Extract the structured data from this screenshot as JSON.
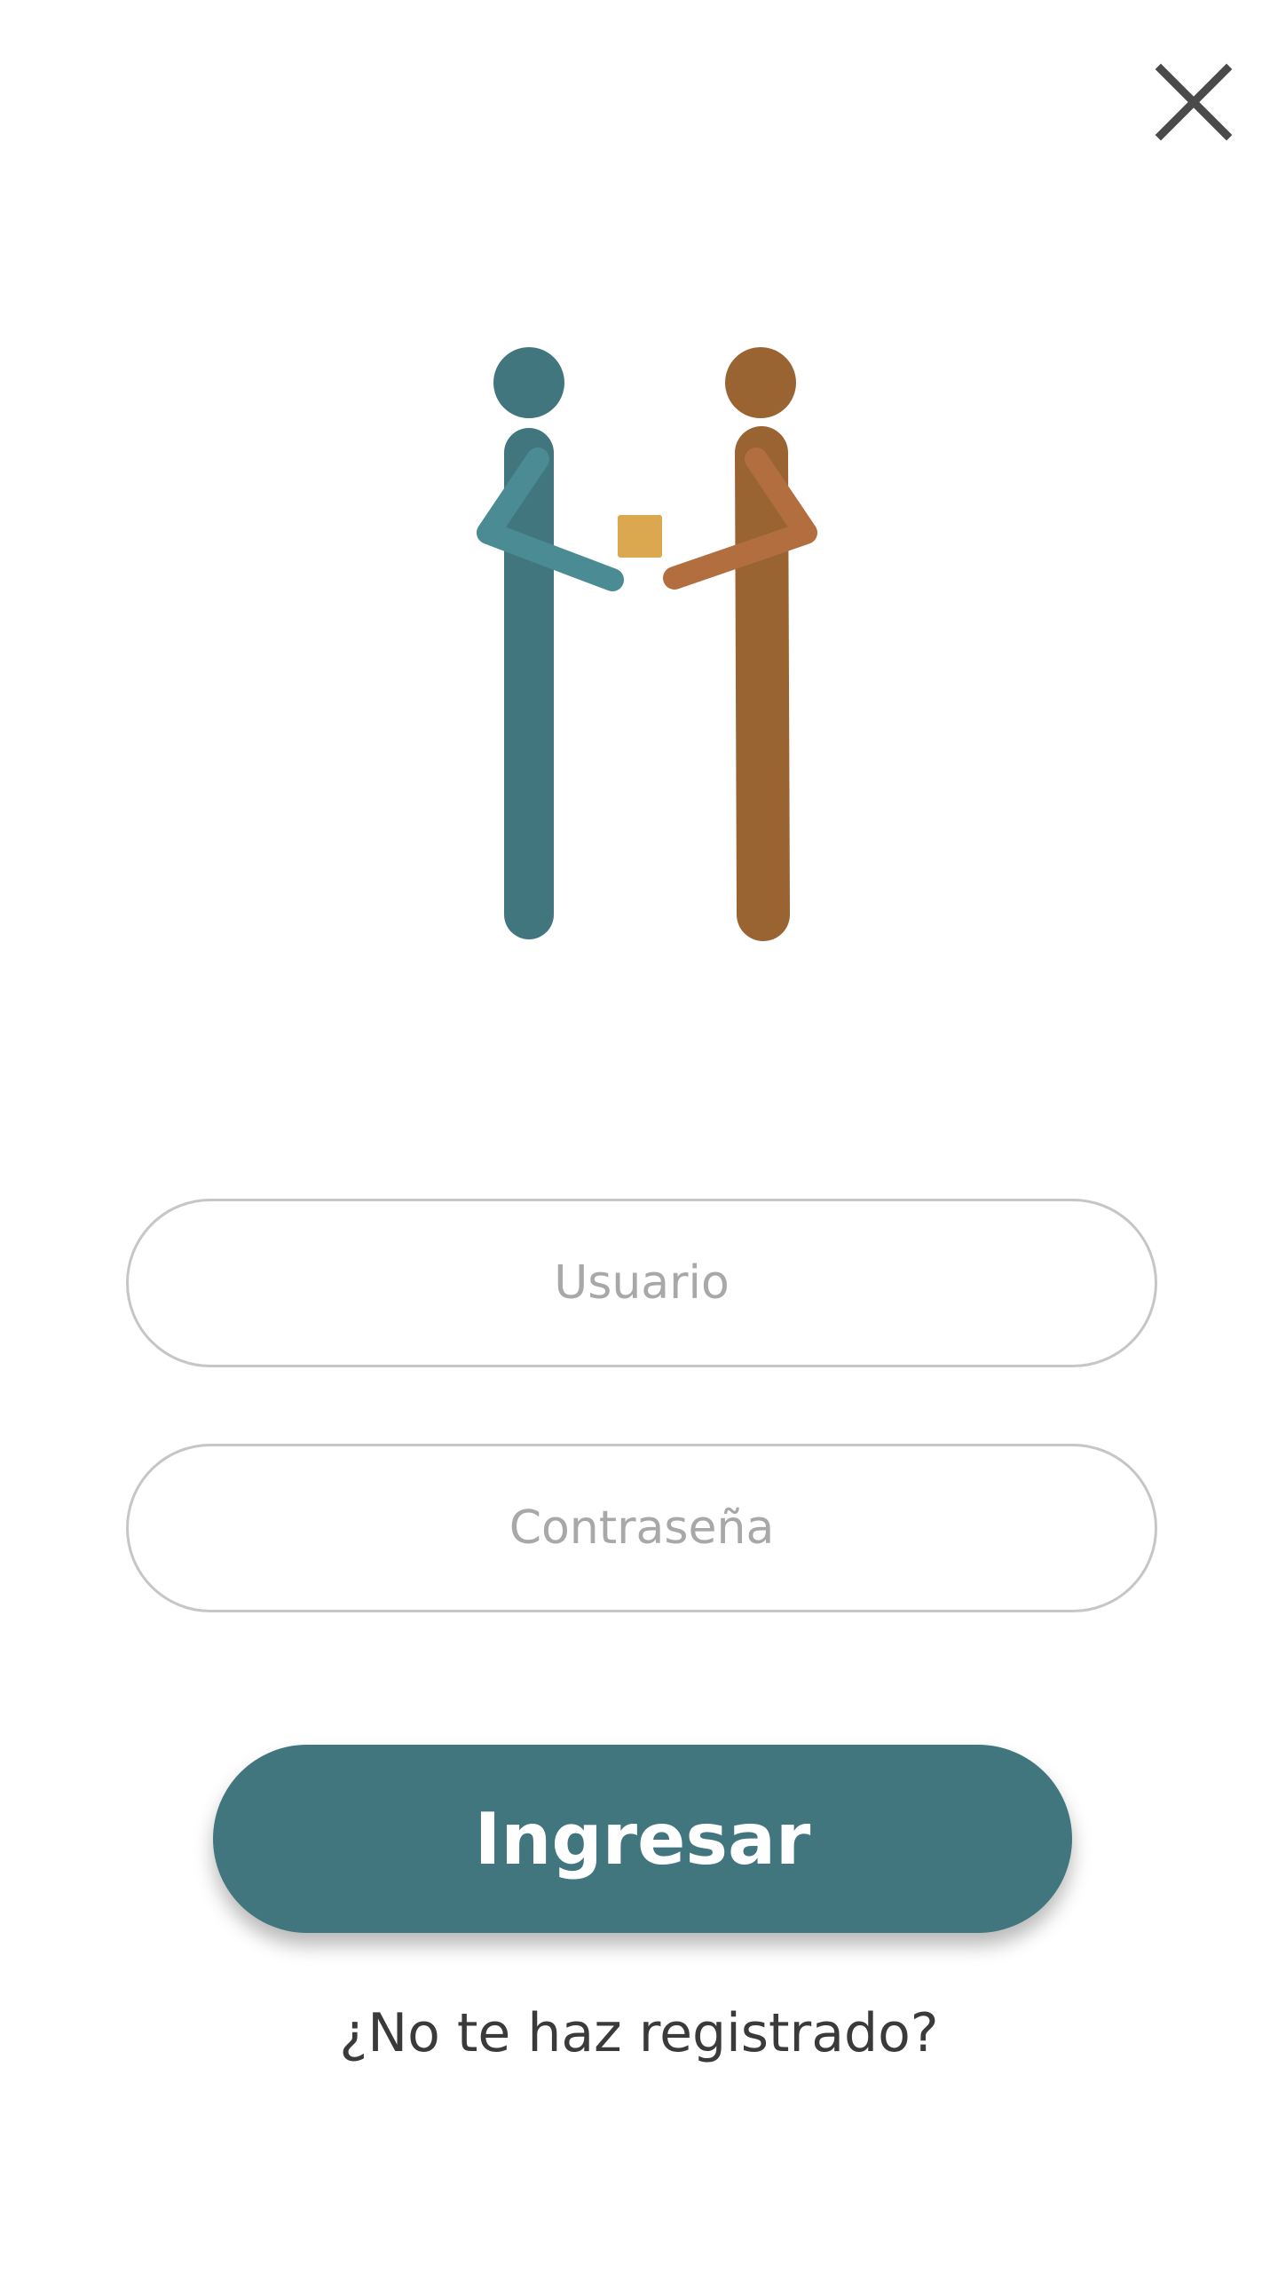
{
  "header": {
    "close_icon": "close-icon"
  },
  "logo": {
    "icon": "handshake-figures-icon",
    "colors": {
      "left_figure": "#42767f",
      "left_arm": "#4a8b94",
      "right_figure": "#9a6432",
      "right_arm": "#b26e3e",
      "box": "#dca84f"
    }
  },
  "form": {
    "username_placeholder": "Usuario",
    "username_value": "",
    "password_placeholder": "Contraseña",
    "password_value": ""
  },
  "actions": {
    "login_label": "Ingresar",
    "register_label": "¿No te haz registrado?"
  },
  "theme": {
    "primary": "#42767f",
    "field_border": "#c6c6c6",
    "placeholder": "#a8a8a8",
    "text": "#3a3a3a"
  }
}
